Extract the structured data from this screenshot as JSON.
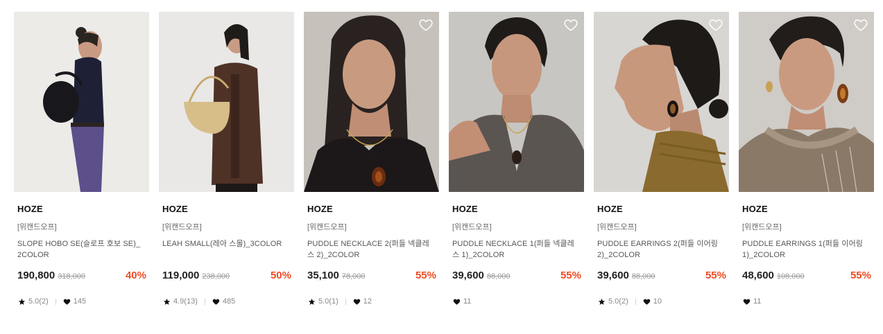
{
  "products": [
    {
      "brand": "HOZE",
      "promo": "[위캔드오프]",
      "name": "SLOPE HOBO SE(슬로프 호보 SE)_ 2COLOR",
      "price": "190,800",
      "original_price": "318,000",
      "discount": "40%",
      "rating": "5.0(2)",
      "likes": "145",
      "image": {
        "bg": "#ece9e6",
        "subject": "bag-shoulder-model",
        "accent": "#1c1b22"
      }
    },
    {
      "brand": "HOZE",
      "promo": "[위캔드오프]",
      "name": "LEAH SMALL(레아 스몰)_3COLOR",
      "price": "119,000",
      "original_price": "238,000",
      "discount": "50%",
      "rating": "4.9(13)",
      "likes": "485",
      "image": {
        "bg": "#e9e7e5",
        "subject": "bag-model-brown-jacket",
        "accent": "#d6bd86"
      }
    },
    {
      "brand": "HOZE",
      "promo": "[위캔드오프]",
      "name": "PUDDLE NECKLACE 2(퍼들 넥클레스 2)_2COLOR",
      "price": "35,100",
      "original_price": "78,000",
      "discount": "55%",
      "rating": "5.0(1)",
      "likes": "12",
      "image": {
        "bg": "#c9c4bf",
        "subject": "necklace-portrait",
        "accent": "#7a3b14"
      }
    },
    {
      "brand": "HOZE",
      "promo": "[위캔드오프]",
      "name": "PUDDLE NECKLACE 1(퍼들 넥클레스 1)_2COLOR",
      "price": "39,600",
      "original_price": "88,000",
      "discount": "55%",
      "rating": "",
      "likes": "11",
      "image": {
        "bg": "#c7c6c3",
        "subject": "necklace-portrait-grey-top",
        "accent": "#5e5a55"
      }
    },
    {
      "brand": "HOZE",
      "promo": "[위캔드오프]",
      "name": "PUDDLE EARRINGS 2(퍼들 이어링 2)_2COLOR",
      "price": "39,600",
      "original_price": "88,000",
      "discount": "55%",
      "rating": "5.0(2)",
      "likes": "10",
      "image": {
        "bg": "#d7d6d3",
        "subject": "earring-profile",
        "accent": "#8f6a2e"
      }
    },
    {
      "brand": "HOZE",
      "promo": "[위캔드오프]",
      "name": "PUDDLE EARRINGS 1(퍼들 이어링 1)_2COLOR",
      "price": "48,600",
      "original_price": "108,000",
      "discount": "55%",
      "rating": "",
      "likes": "11",
      "image": {
        "bg": "#cfcbc6",
        "subject": "earring-portrait-scarf",
        "accent": "#8d7c6b"
      }
    }
  ],
  "colors": {
    "discount": "#ee4b23",
    "price": "#222222",
    "original_price": "#999999"
  },
  "icons": {
    "wishlist": "heart-outline-icon",
    "rating": "star-icon",
    "likes": "heart-filled-icon"
  }
}
